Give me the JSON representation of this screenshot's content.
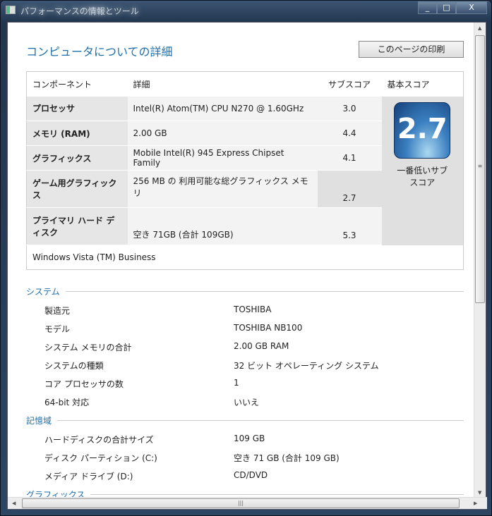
{
  "window": {
    "title": "パフォーマンスの情報とツール",
    "min": "_",
    "max": "□",
    "close": "X"
  },
  "page": {
    "title": "コンピュータについての詳細",
    "print_button": "このページの印刷"
  },
  "table": {
    "headers": [
      "コンポーネント",
      "詳細",
      "サブスコア",
      "基本スコア"
    ],
    "rows": [
      {
        "component": "プロセッサ",
        "detail": "Intel(R) Atom(TM) CPU N270 @ 1.60GHz",
        "subscore": "3.0"
      },
      {
        "component": "メモリ (RAM)",
        "detail": "2.00 GB",
        "subscore": "4.4"
      },
      {
        "component": "グラフィックス",
        "detail": "Mobile Intel(R) 945 Express Chipset Family",
        "subscore": "4.1"
      },
      {
        "component": "ゲーム用グラフィックス",
        "detail": "256 MB の 利用可能な総グラフィックス メモリ",
        "subscore": "2.7"
      },
      {
        "component": "プライマリ ハード ディスク",
        "detail": "空き 71GB (合計 109GB)",
        "subscore": "5.3"
      }
    ],
    "base_score": "2.7",
    "base_score_caption": "一番低いサブスコア",
    "os": "Windows Vista (TM) Business"
  },
  "sections": [
    {
      "title": "システム",
      "items": [
        {
          "label": "製造元",
          "value": "TOSHIBA"
        },
        {
          "label": "モデル",
          "value": "TOSHIBA NB100"
        },
        {
          "label": "システム メモリの合計",
          "value": "2.00 GB RAM"
        },
        {
          "label": "システムの種類",
          "value": "32 ビット オペレーティング システム"
        },
        {
          "label": "コア プロセッサの数",
          "value": "1"
        },
        {
          "label": "64-bit 対応",
          "value": "いいえ"
        }
      ]
    },
    {
      "title": "記憶域",
      "items": [
        {
          "label": "ハードディスクの合計サイズ",
          "value": "109 GB"
        },
        {
          "label": "ディスク パーティション (C:)",
          "value": "空き 71 GB (合計 109 GB)"
        },
        {
          "label": "メディア ドライブ (D:)",
          "value": "CD/DVD"
        }
      ]
    },
    {
      "title": "グラフィックス",
      "items": []
    }
  ]
}
